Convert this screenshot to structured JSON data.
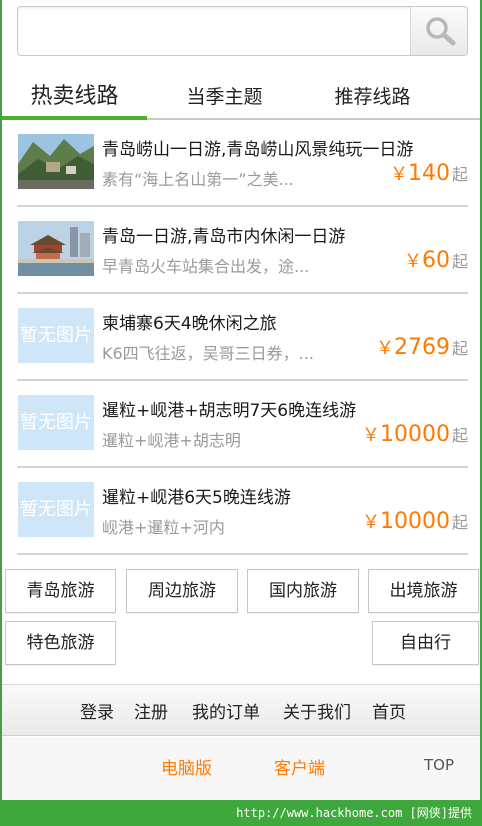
{
  "search": {
    "placeholder": "",
    "value": ""
  },
  "tabs": [
    {
      "label": "热卖线路",
      "active": true
    },
    {
      "label": "当季主题",
      "active": false
    },
    {
      "label": "推荐线路",
      "active": false
    }
  ],
  "routes": [
    {
      "title": "青岛崂山一日游,青岛崂山风景纯玩一日游",
      "desc": "素有“海上名山第一”之美...",
      "currency": "￥",
      "price": "140",
      "suffix": "起",
      "image": "photo-mountain"
    },
    {
      "title": "青岛一日游,青岛市内休闲一日游",
      "desc": "早青岛火车站集合出发，途...",
      "currency": "￥",
      "price": "60",
      "suffix": "起",
      "image": "photo-pavilion"
    },
    {
      "title": "柬埔寨6天4晚休闲之旅",
      "desc": "K6四飞往返，吴哥三日券，...",
      "currency": "￥",
      "price": "2769",
      "suffix": "起",
      "image": "placeholder",
      "image_text": "暂无图片"
    },
    {
      "title": "暹粒+岘港+胡志明7天6晚连线游",
      "desc": "暹粒+岘港+胡志明",
      "currency": "￥",
      "price": "10000",
      "suffix": "起",
      "image": "placeholder",
      "image_text": "暂无图片"
    },
    {
      "title": "暹粒+岘港6天5晚连线游",
      "desc": "岘港+暹粒+河内",
      "currency": "￥",
      "price": "10000",
      "suffix": "起",
      "image": "placeholder",
      "image_text": "暂无图片"
    }
  ],
  "categories": [
    "青岛旅游",
    "周边旅游",
    "国内旅游",
    "出境旅游",
    "特色旅游",
    "自由行"
  ],
  "footer_nav": [
    "登录",
    "注册",
    "我的订单",
    "关于我们",
    "首页"
  ],
  "bottom_links": {
    "pc": "电脑版",
    "client": "客户端",
    "top": "TOP"
  },
  "watermark": "http://www.hackhome.com [网侠]提供",
  "colors": {
    "accent_green": "#4caf2e",
    "price_orange": "#ff7a00",
    "placeholder_blue": "#cfe6f9"
  }
}
